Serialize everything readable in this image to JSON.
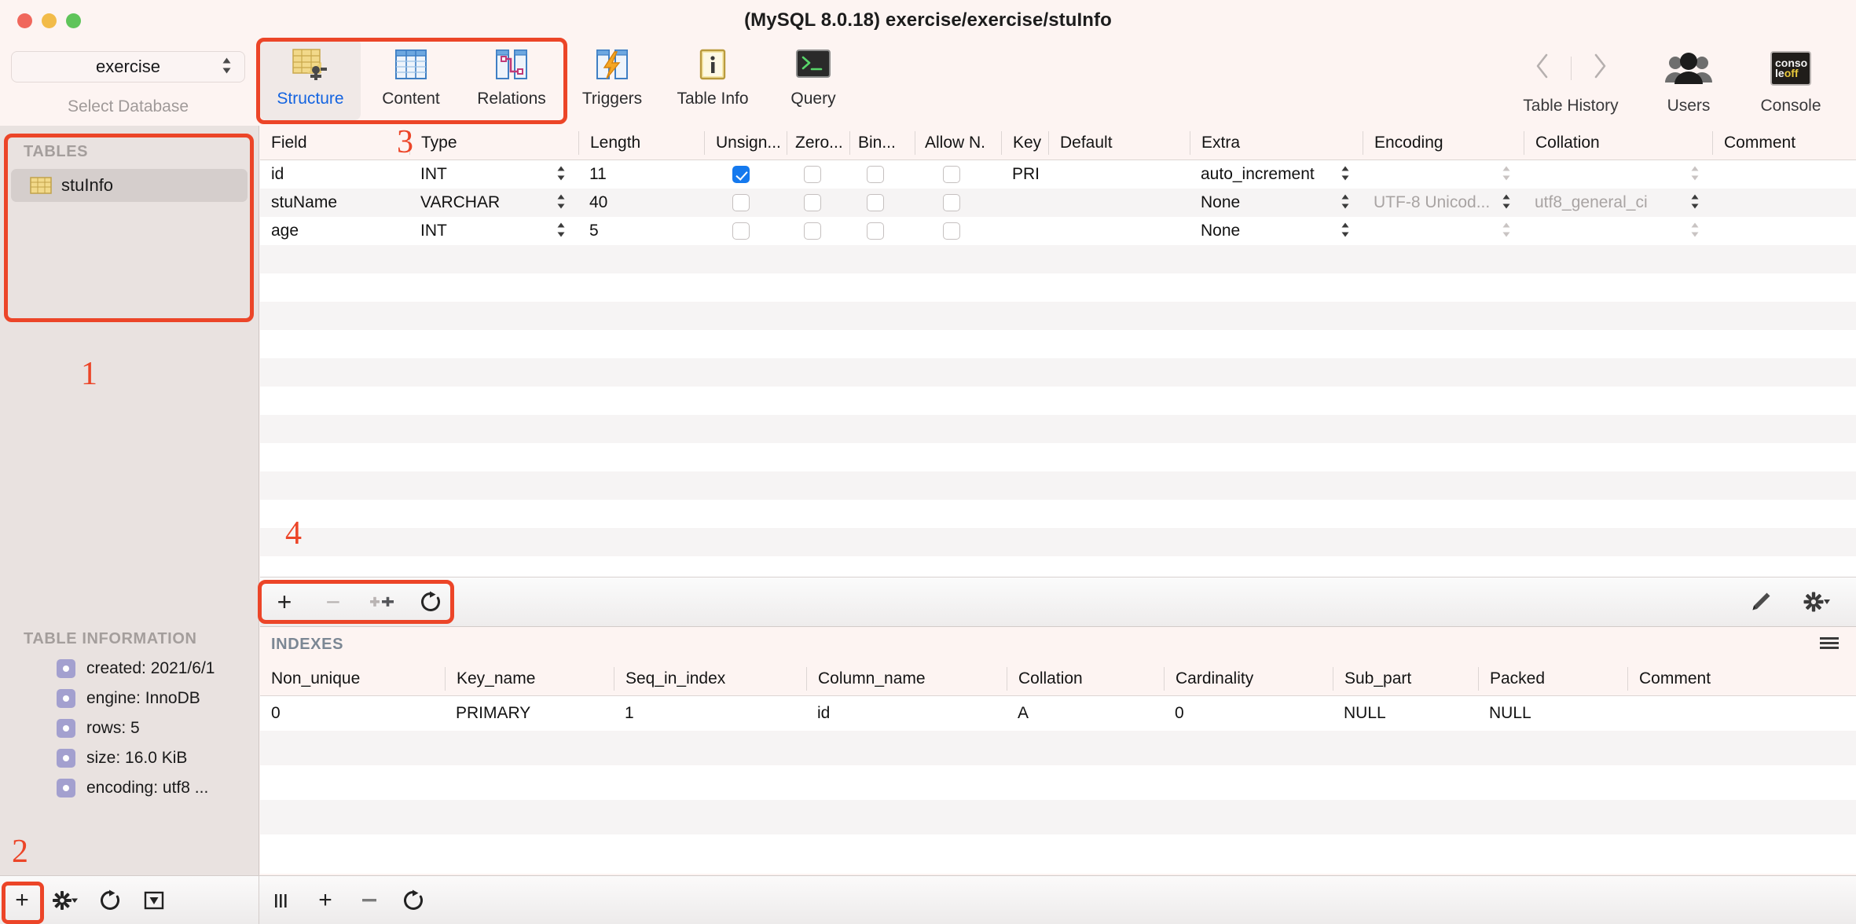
{
  "window": {
    "title": "(MySQL 8.0.18) exercise/exercise/stuInfo",
    "traffic": {
      "close": "close-button",
      "minimize": "minimize-button",
      "zoom": "zoom-button"
    }
  },
  "db_selector": {
    "value": "exercise",
    "caption": "Select Database",
    "chevron": "⌃⌄"
  },
  "toolbar": {
    "tabs": [
      {
        "label": "Structure",
        "icon": "structure-icon",
        "active": true
      },
      {
        "label": "Content",
        "icon": "content-icon",
        "active": false
      },
      {
        "label": "Relations",
        "icon": "relations-icon",
        "active": false
      },
      {
        "label": "Triggers",
        "icon": "triggers-icon",
        "active": false
      },
      {
        "label": "Table Info",
        "icon": "table-info-icon",
        "active": false
      },
      {
        "label": "Query",
        "icon": "query-icon",
        "active": false
      }
    ],
    "right": [
      {
        "label": "Table History",
        "icon": "history-nav-arrows"
      },
      {
        "label": "Users",
        "icon": "users-icon"
      },
      {
        "label": "Console",
        "icon": "console-icon"
      }
    ],
    "console_icon_text": {
      "line1": "conso",
      "line2a": "le",
      "line2b": "off"
    }
  },
  "annotations": [
    {
      "id": "1",
      "text": "1"
    },
    {
      "id": "2",
      "text": "2"
    },
    {
      "id": "3",
      "text": "3"
    },
    {
      "id": "4",
      "text": "4"
    }
  ],
  "sidebar": {
    "tables_title": "TABLES",
    "tables": [
      {
        "name": "stuInfo",
        "selected": true
      }
    ],
    "table_information": {
      "title": "TABLE INFORMATION",
      "rows": [
        "created: 2021/6/1",
        "engine: InnoDB",
        "rows: 5",
        "size: 16.0 KiB",
        "encoding: utf8 ..."
      ]
    }
  },
  "structure": {
    "columns": [
      "Field",
      "Type",
      "Length",
      "Unsign...",
      "Zero...",
      "Bin...",
      "Allow N.",
      "Key",
      "Default",
      "Extra",
      "Encoding",
      "Collation",
      "Comment"
    ],
    "rows": [
      {
        "field": "id",
        "type": "INT",
        "length": "11",
        "unsigned": true,
        "zerofill": false,
        "binary": false,
        "allow_null": false,
        "key": "PRI",
        "default": "",
        "extra": "auto_increment",
        "encoding": "",
        "collation": "",
        "comment": ""
      },
      {
        "field": "stuName",
        "type": "VARCHAR",
        "length": "40",
        "unsigned": false,
        "zerofill": false,
        "binary": false,
        "allow_null": false,
        "key": "",
        "default": "",
        "extra": "None",
        "encoding": "UTF-8 Unicod...",
        "collation": "utf8_general_ci",
        "comment": ""
      },
      {
        "field": "age",
        "type": "INT",
        "length": "5",
        "unsigned": false,
        "zerofill": false,
        "binary": false,
        "allow_null": false,
        "key": "",
        "default": "",
        "extra": "None",
        "encoding": "",
        "collation": "",
        "comment": ""
      }
    ]
  },
  "field_toolbar": {
    "add": "+",
    "remove": "−",
    "duplicate": "⊹",
    "refresh": "↻",
    "edit": "pencil-icon",
    "settings": "gear-icon"
  },
  "indexes": {
    "title": "INDEXES",
    "columns": [
      "Non_unique",
      "Key_name",
      "Seq_in_index",
      "Column_name",
      "Collation",
      "Cardinality",
      "Sub_part",
      "Packed",
      "Comment"
    ],
    "rows": [
      {
        "non_unique": "0",
        "key_name": "PRIMARY",
        "seq_in_index": "1",
        "column_name": "id",
        "collation": "A",
        "cardinality": "0",
        "sub_part": "NULL",
        "packed": "NULL",
        "comment": ""
      }
    ]
  },
  "bottom_bar": {
    "left": [
      {
        "icon": "add-database-icon",
        "label": "+"
      },
      {
        "icon": "gear-icon",
        "label": "✲"
      },
      {
        "icon": "refresh-icon",
        "label": "↻"
      },
      {
        "icon": "filter-icon",
        "label": "▼"
      }
    ],
    "right": [
      {
        "icon": "panel-toggle-icon",
        "label": "|||"
      },
      {
        "icon": "add-index-icon",
        "label": "+"
      },
      {
        "icon": "remove-index-icon",
        "label": "−"
      },
      {
        "icon": "refresh-index-icon",
        "label": "↻"
      }
    ]
  },
  "colors": {
    "annotation": "#ec4528",
    "accent_blue": "#1464e0",
    "checkbox_blue": "#1579ee",
    "window_bg": "#fdf4f2",
    "sidebar_bg": "#e9e2e0"
  }
}
